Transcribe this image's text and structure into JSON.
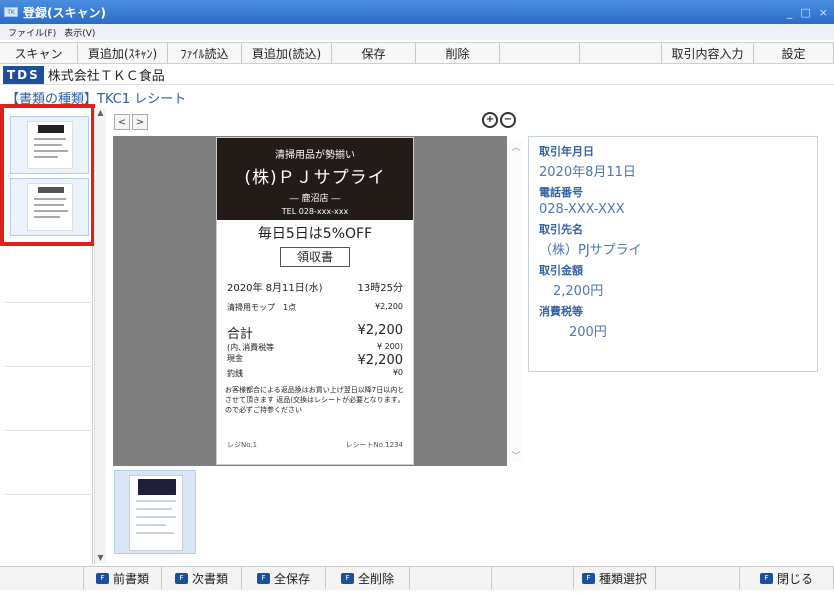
{
  "window": {
    "title": "登録(スキャン)",
    "controls": [
      "_",
      "□",
      "×"
    ]
  },
  "menu": {
    "items": [
      "ファイル(F)",
      "表示(V)"
    ]
  },
  "toolbar": {
    "buttons": [
      "スキャン",
      "頁追加(ｽｷｬﾝ)",
      "ﾌｧｲﾙ読込",
      "頁追加(読込)",
      "保存",
      "削除",
      "",
      "",
      "取引内容入力",
      "設定"
    ]
  },
  "company": {
    "badge": "TDS",
    "name": "株式会社ＴＫＣ食品"
  },
  "doctype": "【書類の種類】TKC1 レシート",
  "nav": {
    "prev": "<",
    "next": ">"
  },
  "zoom": {
    "in": "+",
    "out": "−"
  },
  "receipt": {
    "header_line1": "清掃用品が勢揃い",
    "store_name": "(株)ＰＪサプライ",
    "branch": "― 鹿沼店 ―",
    "tel": "TEL 028-xxx-xxx",
    "promo": "毎日5日は5%OFF",
    "title": "領収書",
    "date": "2020年 8月11日(水)",
    "time": "13時25分",
    "item_name": "清掃用モップ　1点",
    "item_price": "¥2,200",
    "total_label": "合計",
    "total_value": "¥2,200",
    "tax_label": "(内､消費税等",
    "tax_value": "¥ 200)",
    "cash_label": "現金",
    "cash_value": "¥2,200",
    "change_label": "釣銭",
    "change_value": "¥0",
    "note": "お客様都合による返品換はお買い上げ翌日以降7日以内とさせて頂きます 返品(交換はレシートが必要となります｡ので必ずご持参ください",
    "register": "レジNo.1",
    "receipt_no": "レシートNo.1234"
  },
  "info": [
    {
      "label": "取引年月日",
      "value": "2020年8月11日"
    },
    {
      "label": "電話番号",
      "value": "028-XXX-XXX"
    },
    {
      "label": "取引先名",
      "value": "（株）PJサプライ"
    },
    {
      "label": "取引金額",
      "value": "2,200円"
    },
    {
      "label": "消費税等",
      "value": "200円"
    }
  ],
  "fkeys": [
    {
      "key": "F",
      "label": "前書類"
    },
    {
      "key": "F",
      "label": "次書類"
    },
    {
      "key": "F",
      "label": "全保存"
    },
    {
      "key": "F",
      "label": "全削除"
    },
    {
      "key": "F",
      "label": "種類選択"
    },
    {
      "key": "F",
      "label": "閉じる"
    }
  ]
}
